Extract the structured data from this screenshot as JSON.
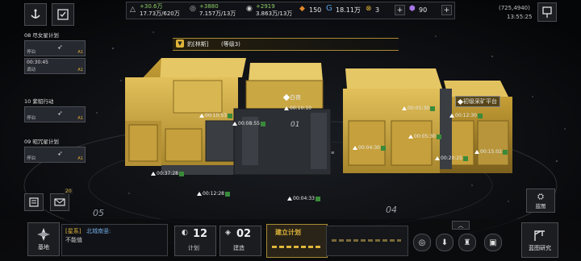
{
  "header": {
    "resources": [
      {
        "icon": "crystal-icon",
        "delta": "+30.6万",
        "amount": "17.73万/620万"
      },
      {
        "icon": "metal-icon",
        "delta": "+3880",
        "amount": "7.157万/13万"
      },
      {
        "icon": "deuterium-icon",
        "delta": "+2919",
        "amount": "3.863万/13万"
      }
    ],
    "stat_a": "150",
    "stat_b": "18.11万",
    "stat_c": "3",
    "stat_d": "90",
    "coords": "(725,4940)",
    "time": "13:55:25"
  },
  "target_banner": {
    "tag": "豹[林斯]",
    "level": "(等级3)"
  },
  "fleets": [
    {
      "title": "08 尽女星计划",
      "cards": [
        {
          "status": "停泊",
          "level": "A1"
        },
        {
          "status": "调动",
          "level": "A1",
          "timer": "00:30:45"
        }
      ]
    },
    {
      "title": "10 紫貂行动",
      "cards": [
        {
          "status": "停泊",
          "level": "A1"
        }
      ]
    },
    {
      "title": "09 昭冗星计划",
      "cards": [
        {
          "status": "停泊",
          "level": "A1"
        }
      ]
    }
  ],
  "map": {
    "base_label": "白夜",
    "mining_label": "初级采矿平台",
    "sector_labels": [
      "05",
      "01",
      "04"
    ],
    "timers": [
      {
        "id": "t1",
        "text": "00:10:53"
      },
      {
        "id": "t2",
        "text": "00:08:55"
      },
      {
        "id": "t3",
        "text": "00:20:25"
      },
      {
        "id": "t4",
        "text": "00:10:10"
      },
      {
        "id": "t5",
        "text": "00:05:30"
      },
      {
        "id": "t6",
        "text": "00:04:30"
      },
      {
        "id": "t7",
        "text": "00:05:30"
      },
      {
        "id": "t8",
        "text": "00:12:30"
      },
      {
        "id": "t9",
        "text": "00:15:02"
      },
      {
        "id": "t10",
        "text": "00:37:28"
      },
      {
        "id": "t11",
        "text": "00:12:28"
      },
      {
        "id": "t12",
        "text": "00:04:33"
      }
    ]
  },
  "bottom": {
    "base_label": "基地",
    "chat_channel": "[星系]",
    "chat_name": "北城南竖:",
    "chat_msg": "不能值",
    "plan_count": "12",
    "plan_label": "计划",
    "build_count": "02",
    "build_label": "建造",
    "build_plan_title": "建立计划",
    "mail_badge": "20",
    "blueprint_label": "蓝图",
    "blueprint_research_label": "蓝图研究"
  },
  "colors": {
    "accent": "#e0b53a",
    "hull": "#c9a742",
    "panel": "#1a1c20"
  }
}
